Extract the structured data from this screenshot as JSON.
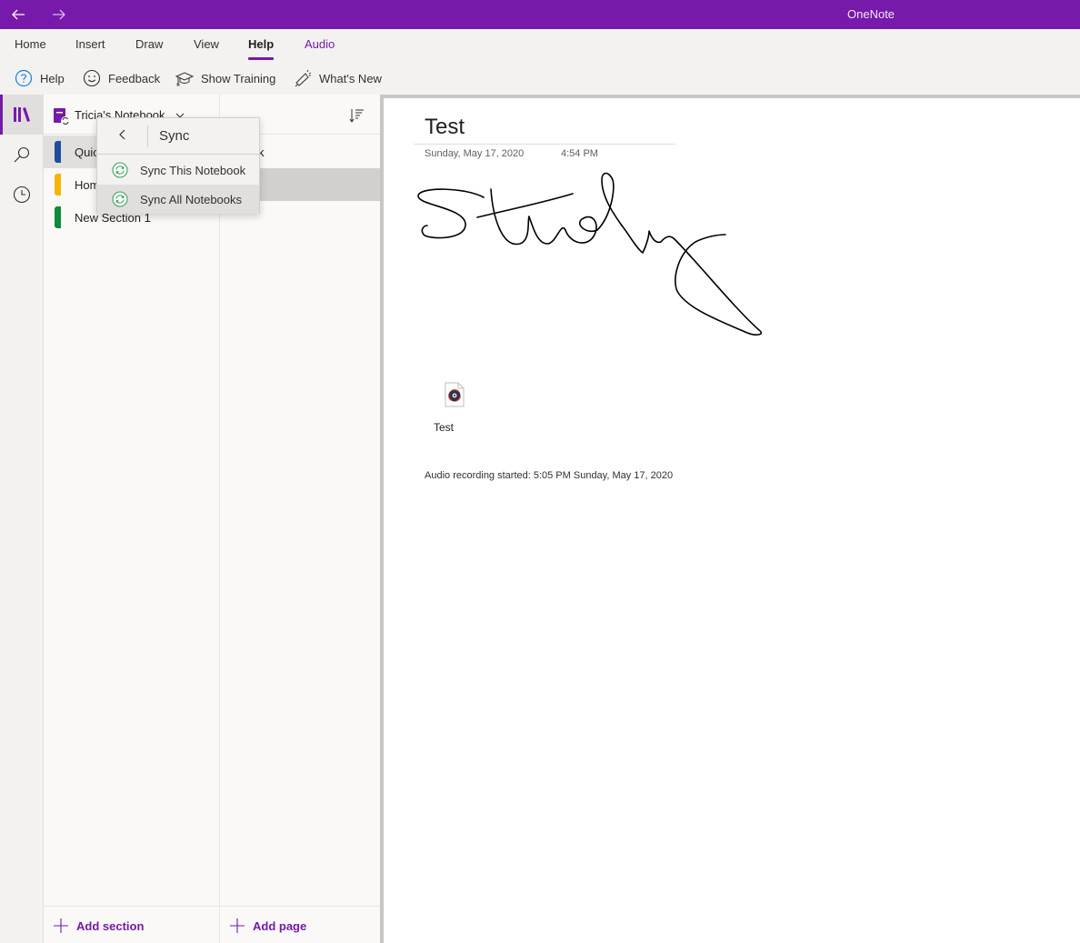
{
  "window": {
    "app_title": "OneNote",
    "back_icon": "arrow-left-icon",
    "forward_icon": "arrow-right-icon"
  },
  "ribbon": {
    "tabs": [
      {
        "label": "Home",
        "state": "normal"
      },
      {
        "label": "Insert",
        "state": "normal"
      },
      {
        "label": "Draw",
        "state": "normal"
      },
      {
        "label": "View",
        "state": "normal"
      },
      {
        "label": "Help",
        "state": "active"
      },
      {
        "label": "Audio",
        "state": "contextual"
      }
    ],
    "commands": [
      {
        "label": "Help",
        "icon": "question-circle-icon"
      },
      {
        "label": "Feedback",
        "icon": "smiley-icon"
      },
      {
        "label": "Show Training",
        "icon": "graduation-cap-icon"
      },
      {
        "label": "What's New",
        "icon": "megaphone-icon"
      }
    ]
  },
  "rail": {
    "items": [
      {
        "name": "notebooks",
        "icon": "library-icon",
        "active": true
      },
      {
        "name": "search",
        "icon": "search-icon",
        "active": false
      },
      {
        "name": "recent",
        "icon": "clock-icon",
        "active": false
      }
    ]
  },
  "notebook": {
    "title": "Tricia's Notebook",
    "icon": "notebook-sync-icon",
    "sort_icon": "sort-icon"
  },
  "sections": [
    {
      "label": "Quick Notes",
      "visible_label": "Quic",
      "color": "#1e4e9c",
      "selected": true
    },
    {
      "label": "Homework",
      "visible_label": "Hom",
      "color": "#f4b400",
      "selected": false
    },
    {
      "label": "New Section 1",
      "visible_label": "New Section 1",
      "color": "#0f8a3c",
      "selected": false
    }
  ],
  "pages": [
    {
      "visible_label": "k",
      "selected": false
    },
    {
      "visible_label": "",
      "selected": true
    }
  ],
  "footer": {
    "add_section": "Add section",
    "add_page": "Add page"
  },
  "sync_popup": {
    "title": "Sync",
    "back_label": "<",
    "items": [
      {
        "label": "Sync This Notebook",
        "icon": "sync-icon"
      },
      {
        "label": "Sync All Notebooks",
        "icon": "sync-icon",
        "hover": true
      }
    ]
  },
  "page": {
    "title": "Test",
    "date": "Sunday, May 17, 2020",
    "time": "4:54 PM",
    "ink_text": "Study",
    "audio_attachment": {
      "label": "Test",
      "icon": "audio-file-icon"
    },
    "audio_note": "Audio recording started: 5:05 PM Sunday, May 17, 2020"
  },
  "colors": {
    "brand": "#7719aa",
    "sync_green": "#3aa25a"
  }
}
